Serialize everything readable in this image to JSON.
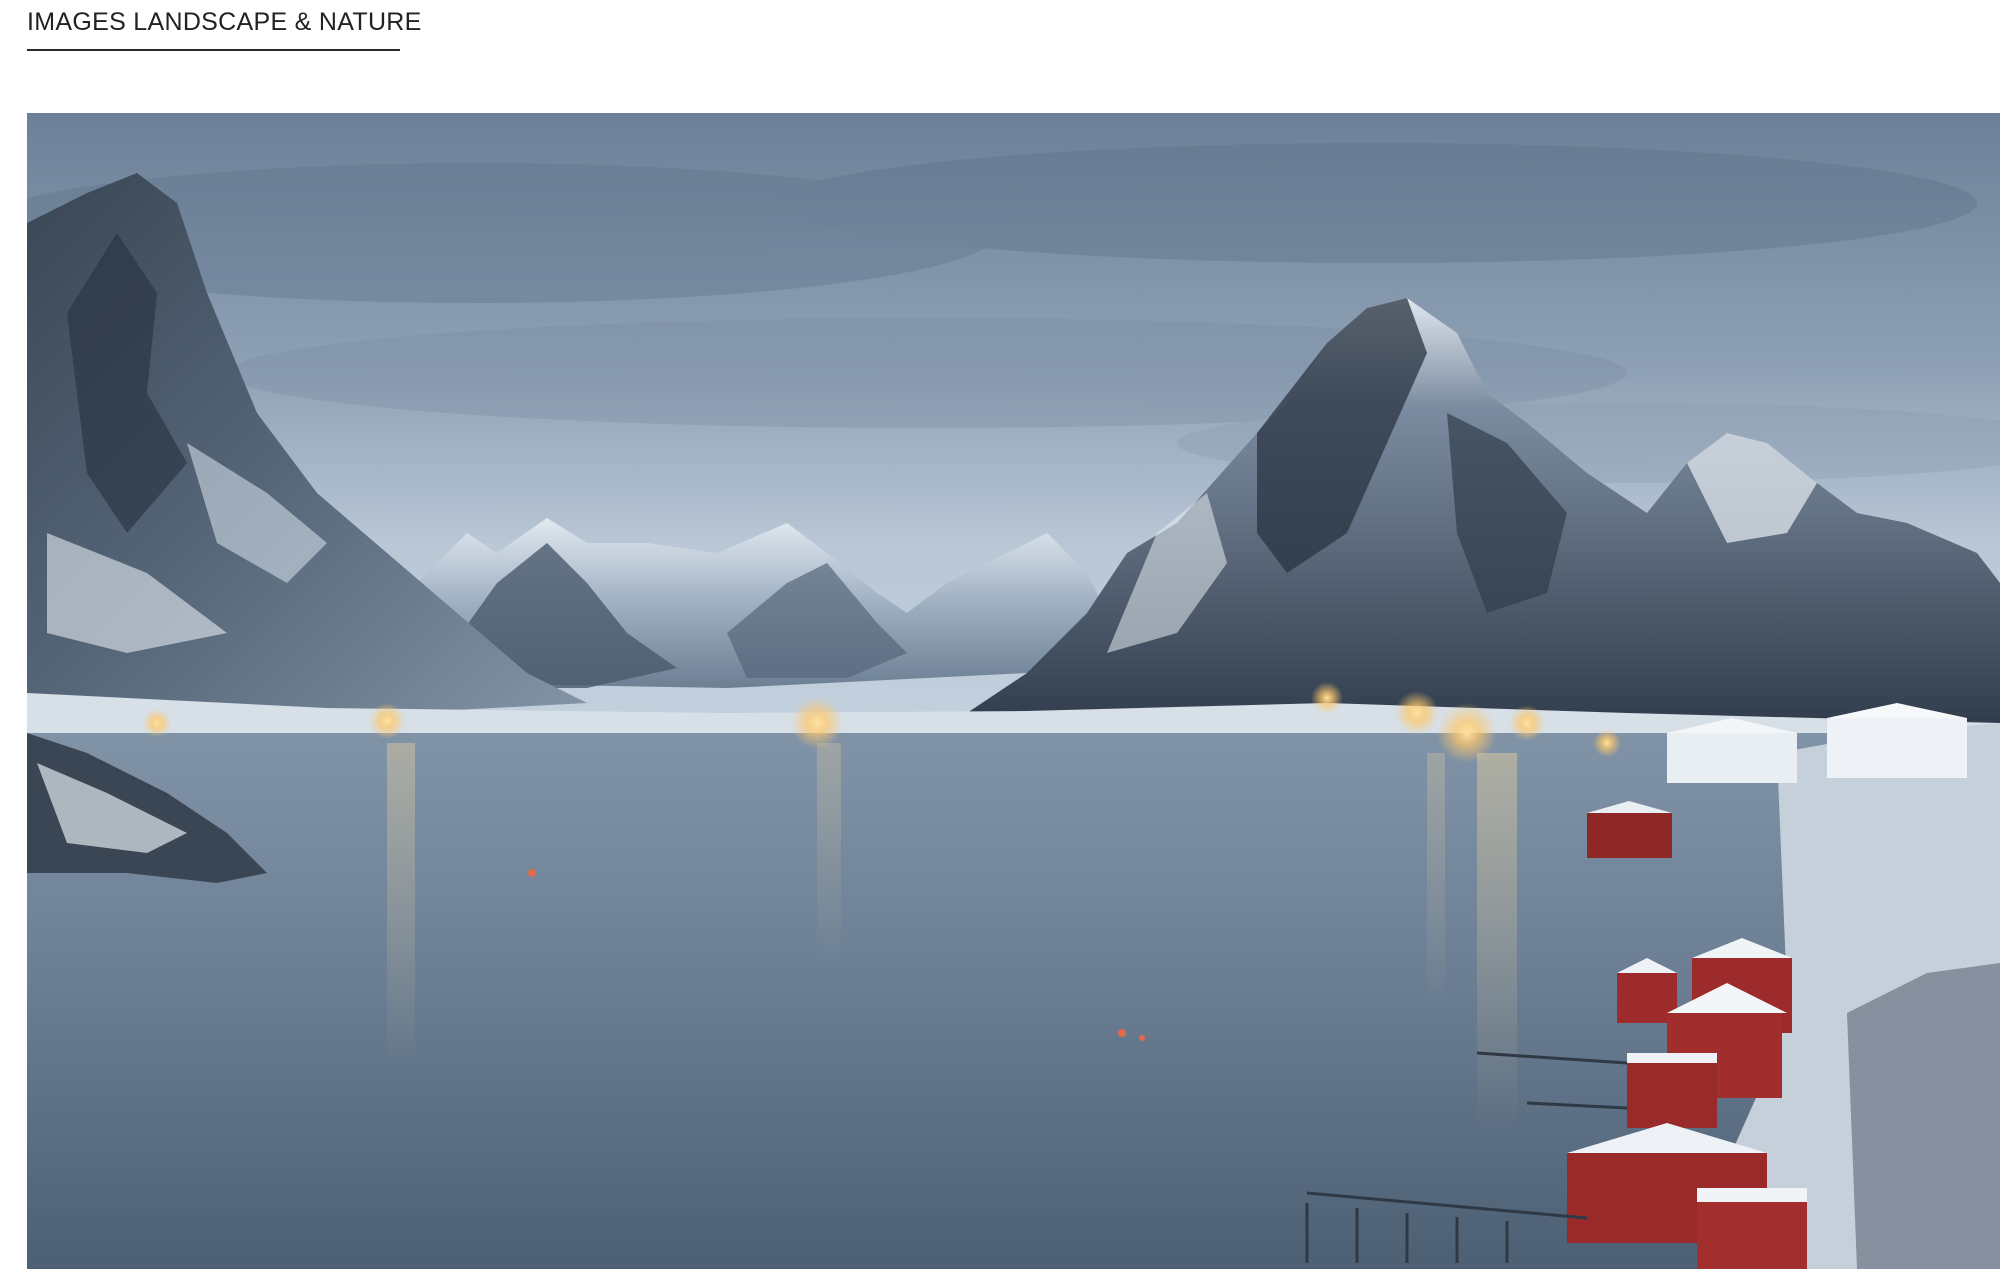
{
  "section": {
    "title": "IMAGES LANDSCAPE & NATURE"
  },
  "photo": {
    "subject": "snowy-mountain-fjord-village-at-dusk",
    "colors": {
      "sky_top": "#6c8098",
      "sky_bottom": "#b9c7d6",
      "water": "#6e8196",
      "mountain_dark": "#2c3644",
      "snow": "#e8edf2",
      "house_red": "#9e2b2b",
      "light_glow": "#ffd27a"
    }
  }
}
